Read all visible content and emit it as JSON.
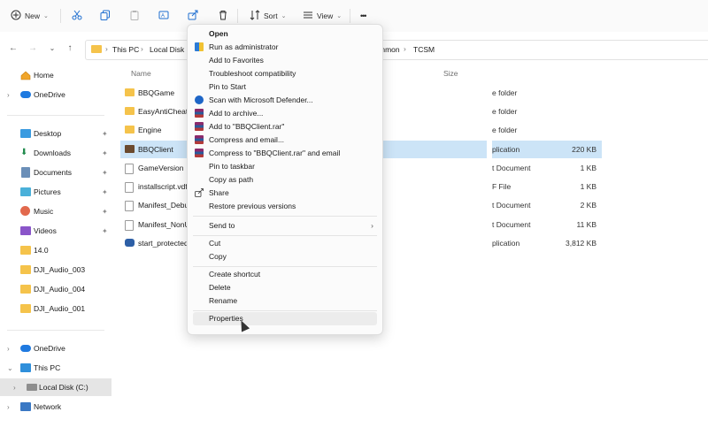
{
  "toolbar": {
    "new_label": "New",
    "sort_label": "Sort",
    "view_label": "View",
    "more_label": "•••"
  },
  "address": {
    "crumbs": [
      "This PC",
      "Local Disk (",
      "mmon",
      "TCSM"
    ],
    "separator": "›"
  },
  "sidebar": {
    "items": [
      {
        "label": "Home"
      },
      {
        "label": "OneDrive"
      },
      {
        "label": "Desktop"
      },
      {
        "label": "Downloads"
      },
      {
        "label": "Documents"
      },
      {
        "label": "Pictures"
      },
      {
        "label": "Music"
      },
      {
        "label": "Videos"
      },
      {
        "label": "14.0"
      },
      {
        "label": "DJI_Audio_003"
      },
      {
        "label": "DJI_Audio_004"
      },
      {
        "label": "DJI_Audio_001"
      },
      {
        "label": "OneDrive"
      },
      {
        "label": "This PC"
      },
      {
        "label": "Local Disk (C:)"
      },
      {
        "label": "Network"
      }
    ]
  },
  "columns": {
    "name": "Name",
    "size": "Size"
  },
  "files": [
    {
      "name": "BBQGame",
      "type": "e folder",
      "size": ""
    },
    {
      "name": "EasyAntiCheat",
      "type": "e folder",
      "size": ""
    },
    {
      "name": "Engine",
      "type": "e folder",
      "size": ""
    },
    {
      "name": "BBQClient",
      "type": "plication",
      "size": "220 KB"
    },
    {
      "name": "GameVersion",
      "type": "t Document",
      "size": "1 KB"
    },
    {
      "name": "installscript.vdf",
      "type": "F File",
      "size": "1 KB"
    },
    {
      "name": "Manifest_Debug",
      "type": "t Document",
      "size": "2 KB"
    },
    {
      "name": "Manifest_NonU",
      "type": "t Document",
      "size": "11 KB"
    },
    {
      "name": "start_protected_",
      "type": "plication",
      "size": "3,812 KB"
    }
  ],
  "context_menu": {
    "items": [
      {
        "label": "Open"
      },
      {
        "label": "Run as administrator"
      },
      {
        "label": "Add to Favorites"
      },
      {
        "label": "Troubleshoot compatibility"
      },
      {
        "label": "Pin to Start"
      },
      {
        "label": "Scan with Microsoft Defender..."
      },
      {
        "label": "Add to archive..."
      },
      {
        "label": "Add to \"BBQClient.rar\""
      },
      {
        "label": "Compress and email..."
      },
      {
        "label": "Compress to \"BBQClient.rar\" and email"
      },
      {
        "label": "Pin to taskbar"
      },
      {
        "label": "Copy as path"
      },
      {
        "label": "Share"
      },
      {
        "label": "Restore previous versions"
      },
      {
        "label": "Send to"
      },
      {
        "label": "Cut"
      },
      {
        "label": "Copy"
      },
      {
        "label": "Create shortcut"
      },
      {
        "label": "Delete"
      },
      {
        "label": "Rename"
      },
      {
        "label": "Properties"
      }
    ],
    "submenu_arrow": "›"
  },
  "colors": {
    "selection": "#cce4f7",
    "folder": "#f5c34b",
    "accent": "#0067c0"
  }
}
